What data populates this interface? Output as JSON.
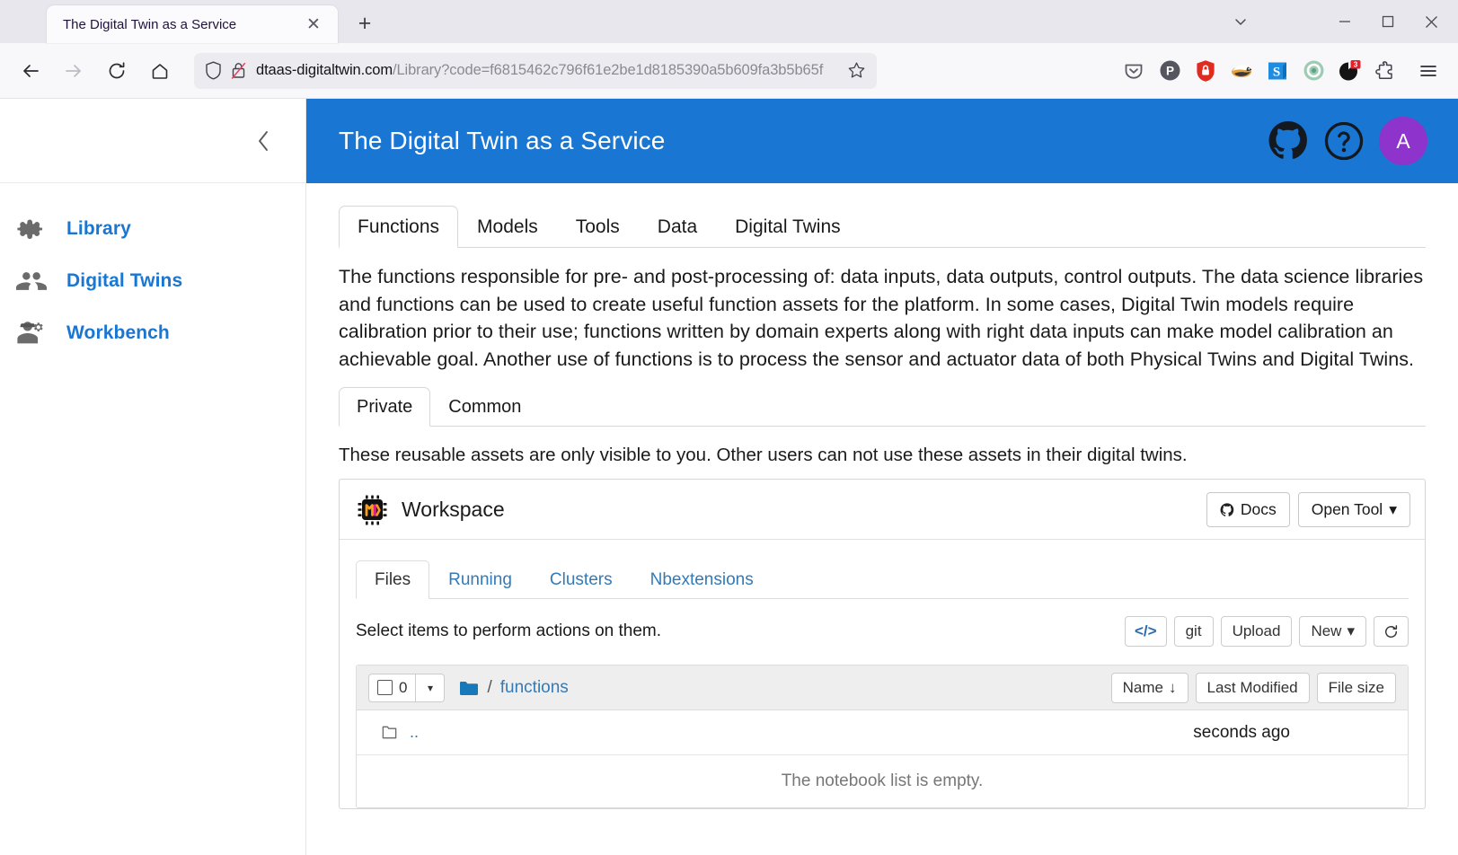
{
  "browser": {
    "tab": {
      "title": "The Digital Twin as a Service",
      "close_label": "✕"
    },
    "new_tab_label": "+",
    "window_controls": {
      "list_all_tabs": "⌄",
      "minimize": "—",
      "maximize": "□",
      "close": "✕"
    },
    "nav": {
      "back": "←",
      "forward": "→",
      "reload": "↻",
      "home": "⌂"
    },
    "url": {
      "host": "dtaas-digitaltwin.com",
      "path": "/Library?code=f6815462c796f61e2be1d8185390a5b609fa3b5b65f"
    },
    "extensions": [
      {
        "name": "pocket-icon",
        "color": "#5b5b66"
      },
      {
        "name": "p-extension-icon",
        "color": "#555560"
      },
      {
        "name": "password-manager-icon",
        "color": "#e02b20"
      },
      {
        "name": "privacy-badger-icon",
        "color": "#d98f33"
      },
      {
        "name": "s-extension-icon",
        "color": "#1f8ce0"
      },
      {
        "name": "green-circle-extension-icon",
        "color": "#7cb89a"
      },
      {
        "name": "dark-extension-icon",
        "color": "#1a1a1a",
        "badge": "3",
        "badge_color": "#e4202a"
      },
      {
        "name": "extensions-puzzle-icon",
        "color": "#42414d"
      }
    ],
    "menu_label": "☰"
  },
  "sidebar": {
    "collapse_label": "‹",
    "items": [
      {
        "label": "Library",
        "icon": "puzzle-piece-icon"
      },
      {
        "label": "Digital Twins",
        "icon": "people-icon"
      },
      {
        "label": "Workbench",
        "icon": "worker-gear-icon"
      }
    ]
  },
  "appbar": {
    "title": "The Digital Twin as a Service",
    "github_icon": "github-icon",
    "help_icon": "help-circle-icon",
    "avatar_initial": "A",
    "accent_color": "#1976d2",
    "avatar_color": "#8e33cc"
  },
  "main": {
    "tabs": [
      {
        "label": "Functions",
        "active": true
      },
      {
        "label": "Models",
        "active": false
      },
      {
        "label": "Tools",
        "active": false
      },
      {
        "label": "Data",
        "active": false
      },
      {
        "label": "Digital Twins",
        "active": false
      }
    ],
    "description": "The functions responsible for pre- and post-processing of: data inputs, data outputs, control outputs. The data science libraries and functions can be used to create useful function assets for the platform. In some cases, Digital Twin models require calibration prior to their use; functions written by domain experts along with right data inputs can make model calibration an achievable goal. Another use of functions is to process the sensor and actuator data of both Physical Twins and Digital Twins.",
    "sub_tabs": [
      {
        "label": "Private",
        "active": true
      },
      {
        "label": "Common",
        "active": false
      }
    ],
    "note": "These reusable assets are only visible to you. Other users can not use these assets in their digital twins."
  },
  "workspace_card": {
    "icon": "ml-workspace-chip-icon",
    "title": "Workspace",
    "docs_button": "Docs",
    "docs_icon": "github-mark-icon",
    "open_tool_button": "Open Tool",
    "open_tool_caret": "▾"
  },
  "notebook": {
    "tabs": [
      {
        "label": "Files",
        "active": true
      },
      {
        "label": "Running",
        "active": false
      },
      {
        "label": "Clusters",
        "active": false
      },
      {
        "label": "Nbextensions",
        "active": false
      }
    ],
    "hint": "Select items to perform actions on them.",
    "toolbar": [
      {
        "name": "code-console-button",
        "label": "</>"
      },
      {
        "name": "git-button",
        "label": "git"
      },
      {
        "name": "upload-button",
        "label": "Upload"
      },
      {
        "name": "new-button",
        "label": "New",
        "caret": "▾"
      },
      {
        "name": "refresh-button",
        "label": "↻"
      }
    ],
    "selection_count": "0",
    "select_caret": "▾",
    "breadcrumb_separator": "/",
    "breadcrumb_current": "functions",
    "columns": [
      {
        "label": "Name",
        "sort_indicator": "↓"
      },
      {
        "label": "Last Modified",
        "sort_indicator": ""
      },
      {
        "label": "File size",
        "sort_indicator": ""
      }
    ],
    "rows": [
      {
        "name": "..",
        "icon": "folder-up-icon",
        "modified": "seconds ago",
        "size": ""
      }
    ],
    "empty_message": "The notebook list is empty."
  }
}
